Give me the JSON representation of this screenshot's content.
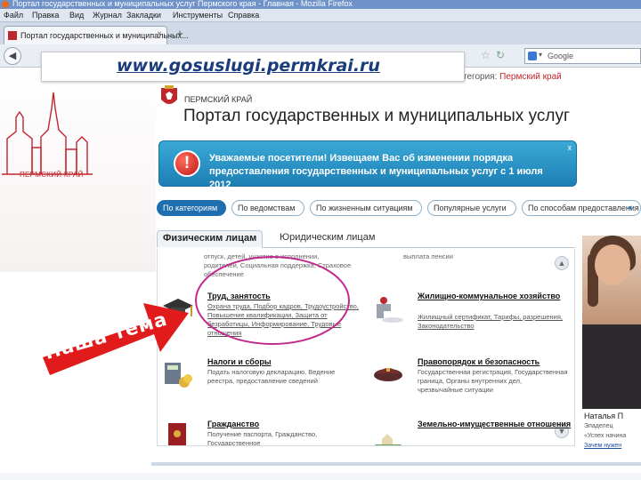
{
  "browser": {
    "window_title": "Портал государственных и муниципальных услуг Пермского края - Главная - Mozilla Firefox",
    "menu": [
      "Файл",
      "Правка",
      "Вид",
      "Журнал",
      "Закладки",
      "Инструменты",
      "Справка"
    ],
    "tab_label": "Портал государственных и муниципальных...",
    "search_value": "Google"
  },
  "overlay": {
    "url_text": "www.gosuslugi.permkrai.ru",
    "caption": "Наша тема"
  },
  "header": {
    "category_label": "тегория:",
    "category_value": "Пермский край",
    "region_small": "ПЕРМСКИЙ КРАЙ",
    "portal_title": "Портал государственных и муниципальных услуг",
    "left_logo_text": "ПЕРМСКИЙ КРАЙ"
  },
  "notice": {
    "text": "Уважаемые посетители! Извещаем Вас об изменении порядка предоставления государственных и муниципальных услуг с 1 июля 2012",
    "close": "x"
  },
  "tabs": [
    {
      "label": "По категориям",
      "active": true
    },
    {
      "label": "По ведомствам",
      "active": false
    },
    {
      "label": "По жизненным ситуациям",
      "active": false
    },
    {
      "label": "Популярные услуги",
      "active": false
    },
    {
      "label": "По способам предоставления",
      "active": false
    }
  ],
  "subtabs": {
    "individuals": "Физическим лицам",
    "legal": "Юридическим лицам"
  },
  "snippets": {
    "left": "отпуск, детей, участие в исполнении, родителей, Социальная поддержка, Страховое обеспечение",
    "right": "выплата пенсии"
  },
  "categories": [
    {
      "name": "Труд, занятость",
      "desc": "Охрана труда, Подбор кадров, Трудоустройство, Повышение квалификации, Защита от безработицы, Информирование, Трудовые отношения"
    },
    {
      "name": "Жилищно-коммунальное хозяйство",
      "desc": "Жилищный сертификат, Тарифы, разрешения, Законодательство"
    },
    {
      "name": "Налоги и сборы",
      "desc": "Подать налоговую декларацию, Ведение реестра, предоставление сведений"
    },
    {
      "name": "Правопорядок и безопасность",
      "desc": "Государственная регистрация, Государственная граница, Органы внутренних дел, чрезвычайные ситуации"
    },
    {
      "name": "Гражданство",
      "desc": "Получение паспорта, Гражданство, Государственное"
    },
    {
      "name": "Земельно-имущественные отношения",
      "desc": ""
    }
  ],
  "sidebar_person": {
    "name_line": "Наталья П",
    "role_line": "Эладелец",
    "quote": "«Успех начина",
    "link": "Зачем нужен"
  },
  "colors": {
    "accent_blue": "#1f6fb0",
    "notice_blue": "#2a94c8",
    "brand_red": "#c0272d",
    "annotation_magenta": "#c02a8e"
  }
}
